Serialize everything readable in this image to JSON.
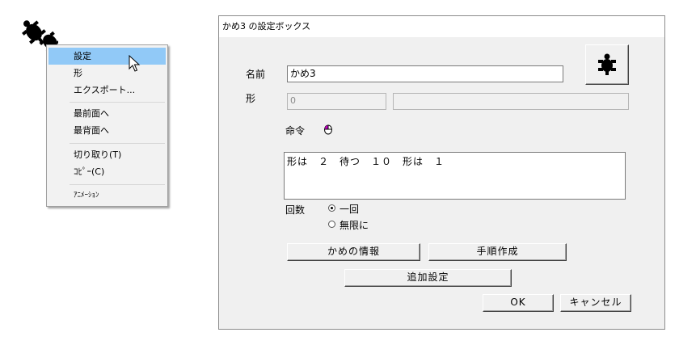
{
  "dialog": {
    "title": "かめ3 の設定ボックス",
    "name_label": "名前",
    "name_value": "かめ3",
    "shape_label": "形",
    "shape_value": "0",
    "shape_name_value": "",
    "command_label": "命令",
    "command_text": "形は　２　待つ　１０　形は　１",
    "repeat_label": "回数",
    "repeat_options": [
      "一回",
      "無限に"
    ],
    "repeat_selected": "一回",
    "turtle_info_button": "かめの情報",
    "procedure_button": "手順作成",
    "extra_settings_button": "追加設定",
    "ok_button": "OK",
    "cancel_button": "キャンセル"
  },
  "context_menu": {
    "items": [
      "設定",
      "形",
      "エクスポート...",
      "最前面へ",
      "最背面へ",
      "切り取り(T)",
      "ｺﾋﾟｰ(C)",
      "ｱﾆﾒｰｼｮﾝ"
    ],
    "highlighted": "設定"
  },
  "icons": {
    "desktop_turtle": "turtle-icon",
    "dialog_turtle": "turtle-icon",
    "cursor": "arrow-cursor-icon",
    "command_mouse": "mouse-icon"
  }
}
